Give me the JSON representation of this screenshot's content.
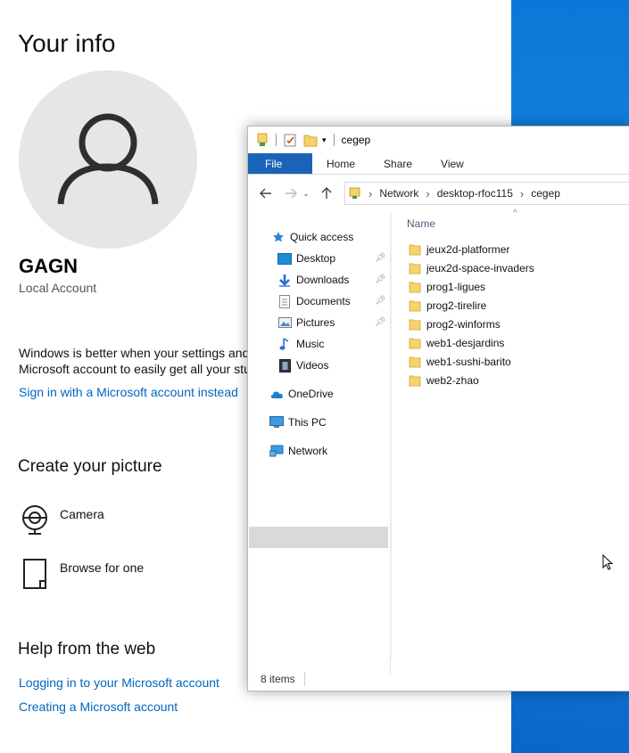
{
  "settings": {
    "title": "Your info",
    "user_name": "GAGN",
    "account_type": "Local Account",
    "info_line1": "Windows is better when your settings and",
    "info_line2": "Microsoft account to easily get all your stu",
    "signin_link": "Sign in with a Microsoft account instead",
    "create_picture_title": "Create your picture",
    "camera_label": "Camera",
    "browse_label": "Browse for one",
    "help_title": "Help from the web",
    "help_links": [
      "Logging in to your Microsoft account",
      "Creating a Microsoft account"
    ]
  },
  "explorer": {
    "title": "cegep",
    "tabs": [
      "File",
      "Home",
      "Share",
      "View"
    ],
    "breadcrumb": [
      "Network",
      "desktop-rfoc115",
      "cegep"
    ],
    "nav": {
      "quick_access": "Quick access",
      "desktop": "Desktop",
      "downloads": "Downloads",
      "documents": "Documents",
      "pictures": "Pictures",
      "music": "Music",
      "videos": "Videos",
      "onedrive": "OneDrive",
      "this_pc": "This PC",
      "network": "Network"
    },
    "column_name": "Name",
    "files": [
      "jeux2d-platformer",
      "jeux2d-space-invaders",
      "prog1-ligues",
      "prog2-tirelire",
      "prog2-winforms",
      "web1-desjardins",
      "web1-sushi-barito",
      "web2-zhao"
    ],
    "status": "8 items"
  },
  "colors": {
    "accent": "#0067c0",
    "file_tab": "#1a64b8",
    "folder": "#f6d36b",
    "desktop_blue": "#0a78d8"
  }
}
